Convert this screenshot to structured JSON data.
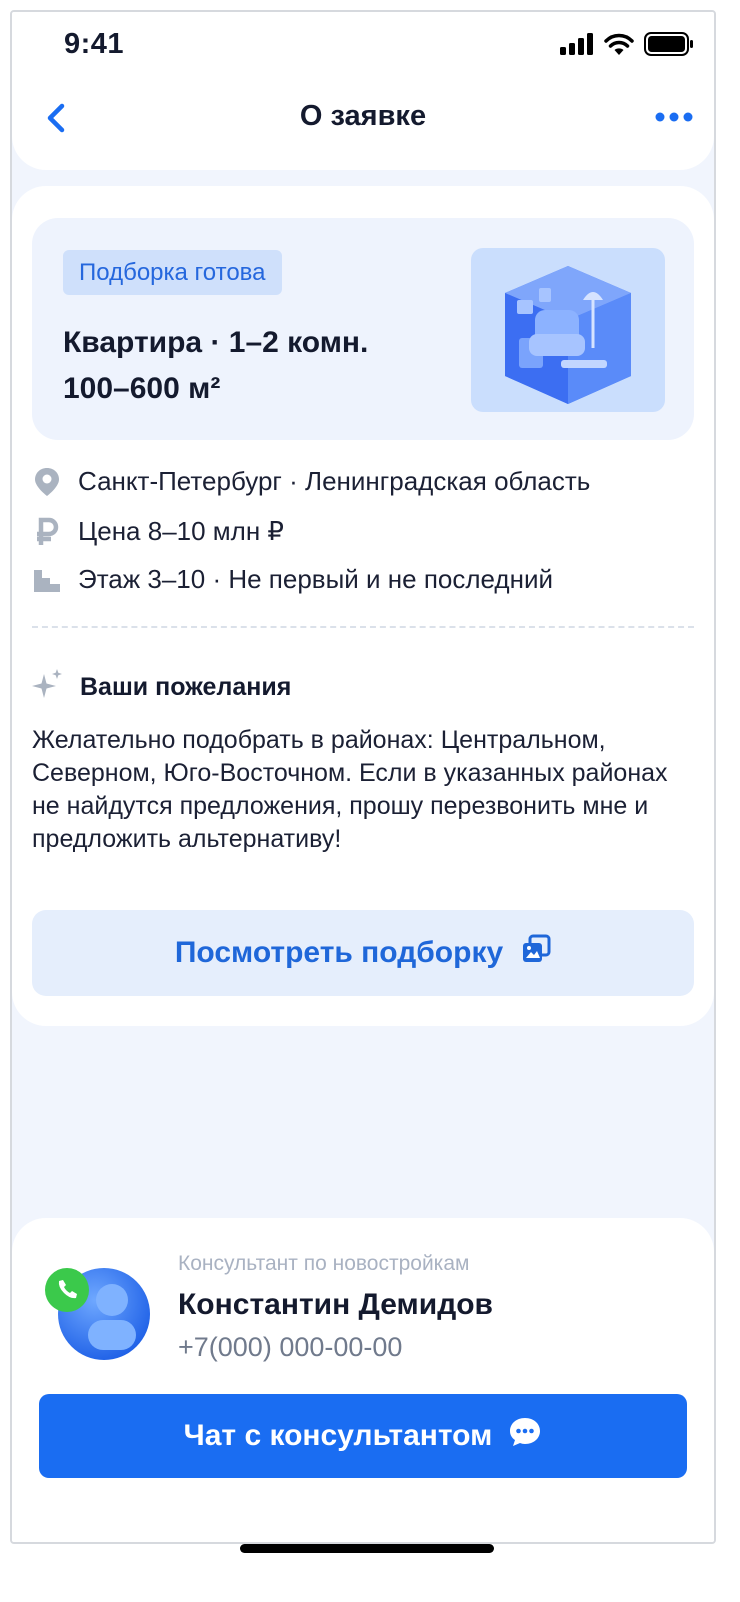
{
  "status_bar": {
    "time": "9:41"
  },
  "nav": {
    "title": "О заявке"
  },
  "hero": {
    "badge": "Подборка готова",
    "line1": "Квартира · 1–2 комн.",
    "line2": "100–600 м²",
    "image_icon": "living-room-illustration"
  },
  "info": [
    {
      "icon": "location-pin-icon",
      "text": "Санкт-Петербург · Ленинградская область"
    },
    {
      "icon": "ruble-icon",
      "text": "Цена 8–10 млн ₽"
    },
    {
      "icon": "floor-stairs-icon",
      "text": "Этаж 3–10 · Не первый и не последний"
    }
  ],
  "wishes": {
    "title": "Ваши пожелания",
    "text": "Желательно подобрать в районах: Центральном, Северном, Юго-Восточном. Если в указанных районах не найдутся предложения, прошу перезвонить мне и предложить альтернативу!"
  },
  "view_button": {
    "label": "Посмотреть подборку"
  },
  "consultant": {
    "role": "Консультант по новостройкам",
    "name": "Константин Демидов",
    "phone": "+7(000) 000-00-00"
  },
  "chat_button": {
    "label": "Чат с консультантом"
  },
  "colors": {
    "accent": "#1a6df2",
    "background": "#f1f5fd",
    "badge_bg": "#cfe0fb",
    "icon_gray": "#aab3c0"
  }
}
